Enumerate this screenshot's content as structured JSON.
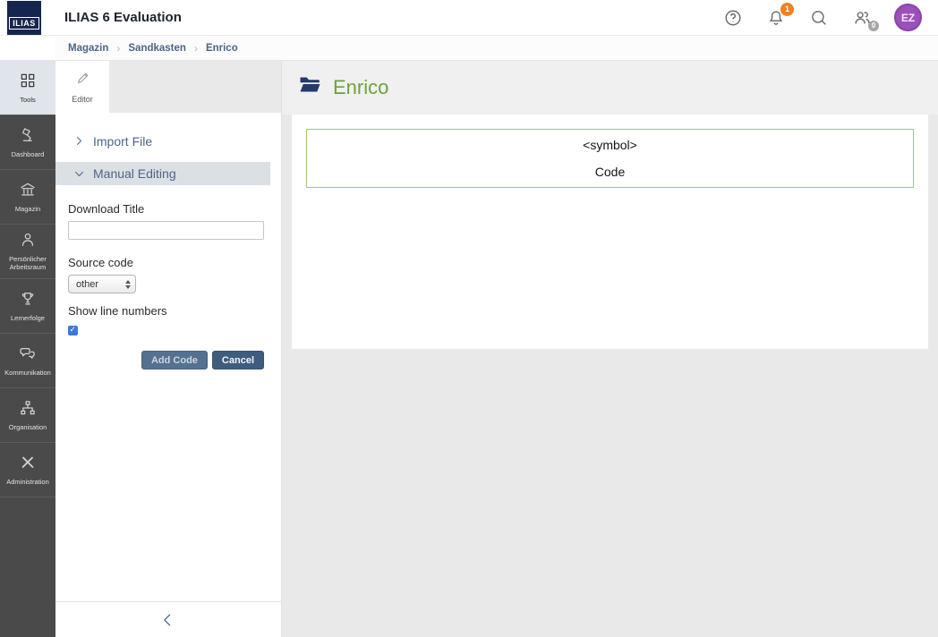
{
  "header": {
    "logo_text": "ILIAS",
    "app_title": "ILIAS 6 Evaluation",
    "notifications_badge": "1",
    "online_users_badge": "0",
    "avatar_initials": "EZ"
  },
  "breadcrumb": {
    "items": [
      {
        "label": "Magazin"
      },
      {
        "label": "Sandkasten"
      },
      {
        "label": "Enrico"
      }
    ]
  },
  "sidebar": {
    "items": [
      {
        "label": "Tools",
        "active": true
      },
      {
        "label": "Dashboard",
        "active": false
      },
      {
        "label": "Magazin",
        "active": false
      },
      {
        "label": "Persönlicher Arbeitsraum",
        "active": false
      },
      {
        "label": "Lernerfolge",
        "active": false
      },
      {
        "label": "Kommunikation",
        "active": false
      },
      {
        "label": "Organisation",
        "active": false
      },
      {
        "label": "Administration",
        "active": false
      }
    ]
  },
  "tool_panel": {
    "editor_tab_label": "Editor",
    "import_file_label": "Import File",
    "manual_editing_label": "Manual Editing",
    "form": {
      "download_title_label": "Download Title",
      "download_title_value": "",
      "source_code_label": "Source code",
      "source_code_selected": "other",
      "show_line_numbers_label": "Show line numbers",
      "show_line_numbers_checked": true,
      "add_code_label": "Add Code",
      "cancel_label": "Cancel"
    }
  },
  "main": {
    "page_title": "Enrico",
    "code_block": {
      "tag_line": "<symbol>",
      "label_line": "Code"
    }
  },
  "colors": {
    "accent_blue": "#4c6586",
    "title_green": "#6ca23e",
    "code_border_green": "#9cc77c",
    "badge_orange": "#ef8121",
    "avatar_purple": "#9b51ba",
    "logo_navy": "#16254e"
  }
}
